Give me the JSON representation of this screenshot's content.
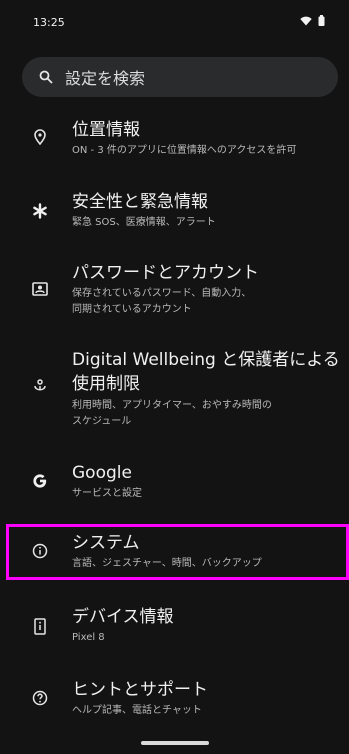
{
  "status_bar": {
    "time": "13:25",
    "wifi_icon": "wifi-icon",
    "battery_icon": "battery-icon"
  },
  "search": {
    "placeholder": "設定を検索",
    "icon": "search-icon"
  },
  "items": [
    {
      "icon": "location-pin-icon",
      "title": "位置情報",
      "subtitle": "ON - 3 件のアプリに位置情報へのアクセスを許可"
    },
    {
      "icon": "asterisk-icon",
      "title": "安全性と緊急情報",
      "subtitle": "緊急 SOS、医療情報、アラート"
    },
    {
      "icon": "contact-card-icon",
      "title": "パスワードとアカウント",
      "subtitle_lines": [
        "保存されているパスワード、自動入力、",
        "同期されているアカウント"
      ]
    },
    {
      "icon": "wellbeing-icon",
      "title_lines": [
        "Digital Wellbeing と保護者による",
        "使用制限"
      ],
      "subtitle_lines": [
        "利用時間、アプリタイマー、おやすみ時間の",
        "スケジュール"
      ]
    },
    {
      "icon": "google-g-icon",
      "title": "Google",
      "subtitle": "サービスと設定"
    },
    {
      "icon": "info-icon",
      "title": "システム",
      "subtitle": "言語、ジェスチャー、時間、バックアップ"
    },
    {
      "icon": "phone-info-icon",
      "title": "デバイス情報",
      "subtitle": "Pixel 8"
    },
    {
      "icon": "help-icon",
      "title": "ヒントとサポート",
      "subtitle": "ヘルプ記事、電話とチャット"
    }
  ],
  "colors": {
    "background": "#131313",
    "highlight": "#ff00ff",
    "search_bg": "#2a2b2d"
  }
}
